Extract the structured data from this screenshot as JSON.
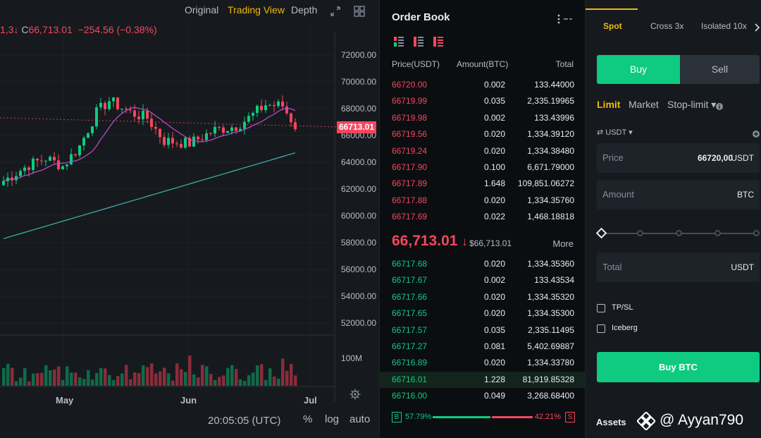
{
  "chart": {
    "tabs": {
      "original": "Original",
      "trading_view": "Trading View",
      "depth": "Depth"
    },
    "active_tab": "Trading View",
    "ohlc_prefix": "1,3↓",
    "ohlc_close_label": "C",
    "ohlc_close_value": "66,713.01",
    "ohlc_change": "−254.56 (−0.38%)",
    "price_axis": [
      "72000.00",
      "70000.00",
      "68000.00",
      "66000.00",
      "64000.00",
      "62000.00",
      "60000.00",
      "58000.00",
      "56000.00",
      "54000.00",
      "52000.00"
    ],
    "current_price_tag": "66713.01",
    "volume_axis_label": "100M",
    "x_labels": [
      "May",
      "Jun",
      "Jul"
    ],
    "time_readout": "20:05:05 (UTC)",
    "bottom_options": {
      "percent": "%",
      "log": "log",
      "auto": "auto"
    }
  },
  "orderbook": {
    "title": "Order Book",
    "headers": {
      "price": "Price(USDT)",
      "amount": "Amount(BTC)",
      "total": "Total"
    },
    "asks": [
      {
        "price": "66720.00",
        "amount": "0.002",
        "total": "133.44000"
      },
      {
        "price": "66719.99",
        "amount": "0.035",
        "total": "2,335.19965"
      },
      {
        "price": "66719.98",
        "amount": "0.002",
        "total": "133.43996"
      },
      {
        "price": "66719.56",
        "amount": "0.020",
        "total": "1,334.39120"
      },
      {
        "price": "66719.24",
        "amount": "0.020",
        "total": "1,334.38480"
      },
      {
        "price": "66717.90",
        "amount": "0.100",
        "total": "6,671.79000"
      },
      {
        "price": "66717.89",
        "amount": "1.648",
        "total": "109,851.06272"
      },
      {
        "price": "66717.88",
        "amount": "0.020",
        "total": "1,334.35760"
      },
      {
        "price": "66717.69",
        "amount": "0.022",
        "total": "1,468.18818"
      }
    ],
    "mid_price": "66,713.01",
    "mid_arrow": "↓",
    "mid_usd": "$66,713.01",
    "more_label": "More",
    "bids": [
      {
        "price": "66717.68",
        "amount": "0.020",
        "total": "1,334.35360"
      },
      {
        "price": "66717.67",
        "amount": "0.002",
        "total": "133.43534"
      },
      {
        "price": "66717.66",
        "amount": "0.020",
        "total": "1,334.35320"
      },
      {
        "price": "66717.65",
        "amount": "0.020",
        "total": "1,334.35300"
      },
      {
        "price": "66717.57",
        "amount": "0.035",
        "total": "2,335.11495"
      },
      {
        "price": "66717.27",
        "amount": "0.081",
        "total": "5,402.69887"
      },
      {
        "price": "66716.89",
        "amount": "0.020",
        "total": "1,334.33780"
      },
      {
        "price": "66716.01",
        "amount": "1.228",
        "total": "81,919.85328"
      },
      {
        "price": "66716.00",
        "amount": "0.049",
        "total": "3,268.68400"
      }
    ],
    "ratio": {
      "buy_label": "B",
      "buy_pct": "57.79%",
      "sell_label": "S",
      "sell_pct": "42.21%",
      "buy_fraction": 0.5779
    }
  },
  "trade": {
    "margin_tabs": {
      "spot": "Spot",
      "cross": "Cross 3x",
      "isolated": "Isolated 10x"
    },
    "buy_tab": "Buy",
    "sell_tab": "Sell",
    "order_types": {
      "limit": "Limit",
      "market": "Market",
      "stop_limit": "Stop-limit ▾"
    },
    "wallet_currency": "USDT ▾",
    "price_field": {
      "label": "Price",
      "value": "66720,00",
      "unit": "USDT"
    },
    "amount_field": {
      "label": "Amount",
      "unit": "BTC"
    },
    "total_field": {
      "label": "Total",
      "unit": "USDT"
    },
    "slider_fraction": 0,
    "tpsl_label": "TP/SL",
    "iceberg_label": "Iceberg",
    "buy_button": "Buy BTC",
    "assets_label": "Assets"
  },
  "watermark": {
    "text": "@ Ayyan790"
  },
  "colors": {
    "accent": "#f0b90b",
    "up": "#0ecb81",
    "down": "#f6465d",
    "panel": "#161a1e",
    "bg": "#0b0e11"
  }
}
